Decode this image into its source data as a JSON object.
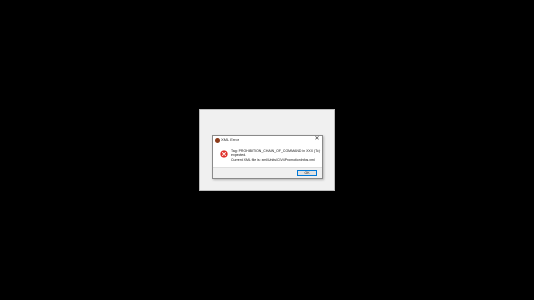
{
  "dialog": {
    "title": "XML Error",
    "close_glyph": "✕",
    "icon": "error-icon",
    "message_line1": "Tag: PROHIBITION_CHAIN_OF_COMMAND in XXX (Tc) was",
    "message_line2": "expected.",
    "message_line3": "Current XML file is: xml\\Units\\CIV4PromotionInfos.xml",
    "ok_label": "OK"
  },
  "colors": {
    "background": "#000000",
    "error_red": "#e0302a",
    "button_border": "#0078d7"
  }
}
